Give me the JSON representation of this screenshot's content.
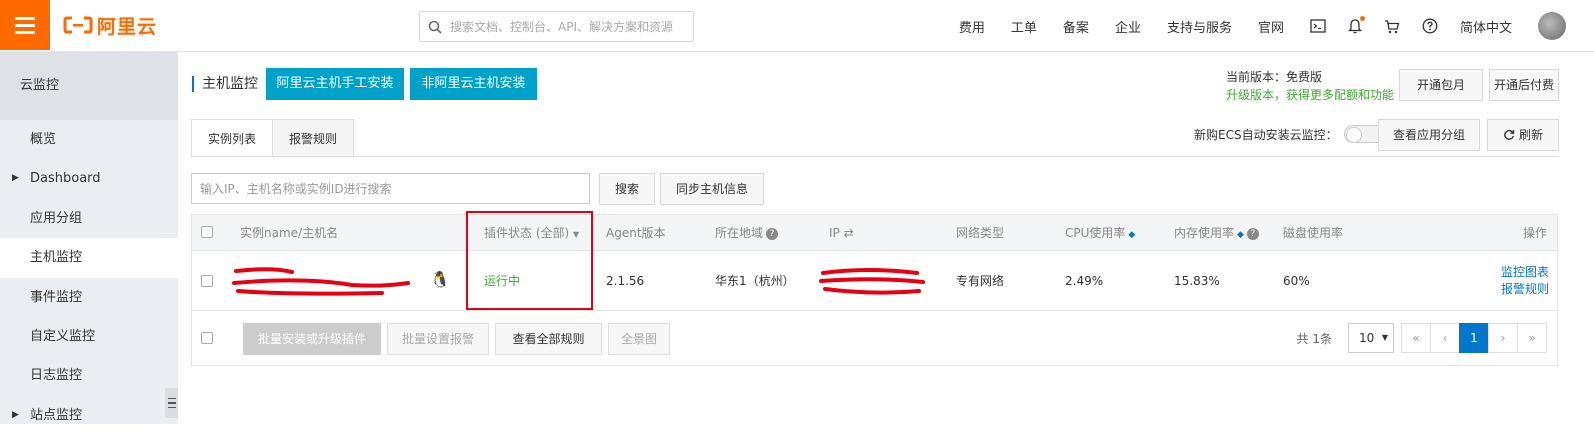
{
  "brand": {
    "logo_text": "阿里云"
  },
  "search": {
    "placeholder": "搜索文档、控制台、API、解决方案和资源"
  },
  "topnav": {
    "items": [
      "费用",
      "工单",
      "备案",
      "企业",
      "支持与服务",
      "官网"
    ],
    "language": "简体中文"
  },
  "sidebar": {
    "title": "云监控",
    "items": [
      {
        "label": "概览"
      },
      {
        "label": "Dashboard",
        "expandable": true
      },
      {
        "label": "应用分组"
      },
      {
        "label": "主机监控",
        "active": true
      },
      {
        "label": "事件监控"
      },
      {
        "label": "自定义监控"
      },
      {
        "label": "日志监控"
      },
      {
        "label": "站点监控",
        "expandable": true
      }
    ]
  },
  "header": {
    "title": "主机监控",
    "install_aliyun_btn": "阿里云主机手工安装",
    "install_other_btn": "非阿里云主机安装",
    "version_text": "当前版本：免费版",
    "upgrade_text": "升级版本，获得更多配额和功能",
    "monthly_btn": "开通包月",
    "postpaid_btn": "开通后付费"
  },
  "tabs": [
    {
      "label": "实例列表",
      "active": true
    },
    {
      "label": "报警规则",
      "active": false
    }
  ],
  "auto_install": {
    "label": "新购ECS自动安装云监控：",
    "enabled": false
  },
  "toolbar": {
    "app_group_btn": "查看应用分组",
    "refresh_btn": "刷新",
    "filter_placeholder": "输入IP、主机名称或实例ID进行搜索",
    "search_btn": "搜索",
    "sync_btn": "同步主机信息"
  },
  "table": {
    "headers": {
      "name": "实例name/主机名",
      "plugin": "插件状态 (全部)",
      "agent": "Agent版本",
      "region": "所在地域",
      "ip": "IP",
      "network": "网络类型",
      "cpu": "CPU使用率",
      "mem": "内存使用率",
      "disk": "磁盘使用率",
      "ops": "操作"
    },
    "rows": [
      {
        "plugin_status": "运行中",
        "agent_version": "2.1.56",
        "region": "华东1（杭州）",
        "network": "专有网络",
        "cpu": "2.49%",
        "mem": "15.83%",
        "disk": "60%",
        "op_chart": "监控图表",
        "op_rules": "报警规则"
      }
    ]
  },
  "footer": {
    "batch_install_btn": "批量安装或升级插件",
    "batch_alarm_btn": "批量设置报警",
    "view_rules_btn": "查看全部规则",
    "panorama_btn": "全景图",
    "total_text": "共 1条",
    "page_size": "10",
    "current_page": "1"
  },
  "colors": {
    "brand": "#ff6a00",
    "action_blue": "#00a2ca",
    "link": "#0077cc",
    "success": "#3eaa2f",
    "highlight": "#e60012"
  }
}
